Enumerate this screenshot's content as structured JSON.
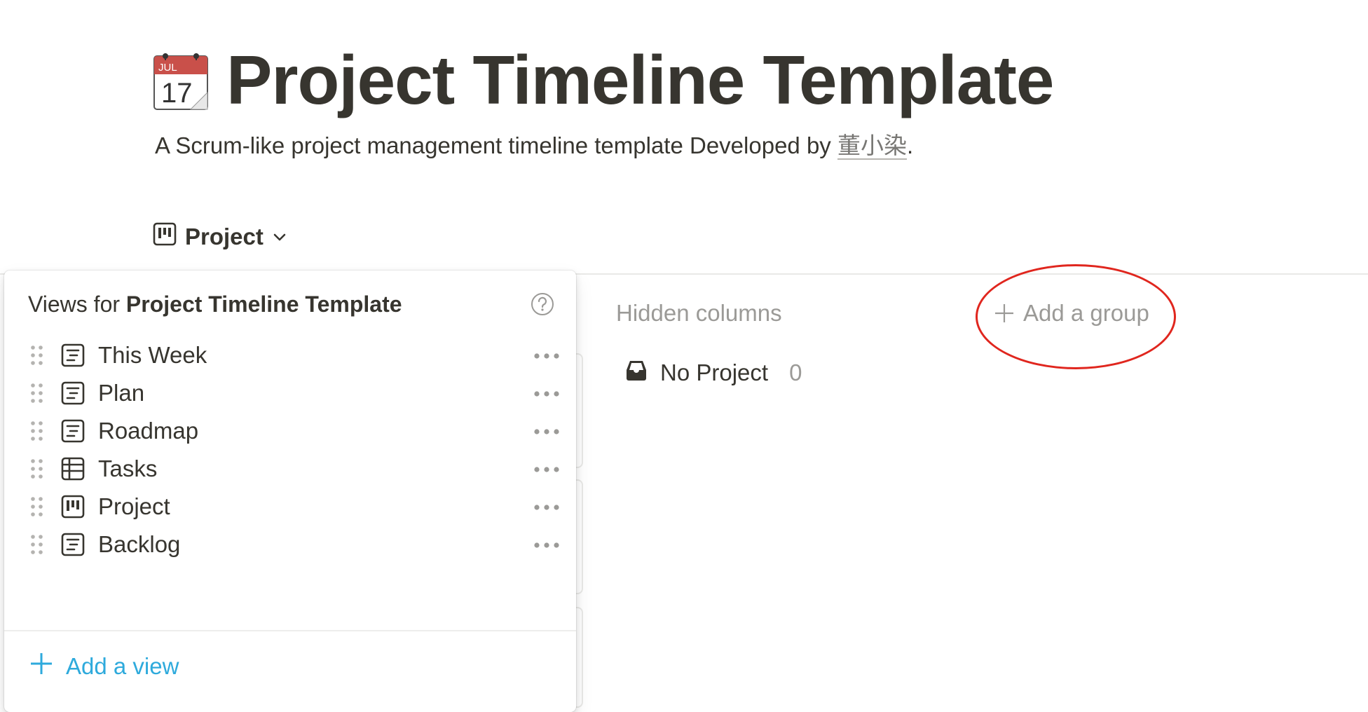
{
  "page": {
    "icon": "calendar-emoji-icon",
    "icon_month": "JUL",
    "icon_day": "17",
    "title": "Project Timeline Template",
    "subtitle_text": "A Scrum-like project management timeline template Developed by ",
    "author": "董小染",
    "subtitle_end": "."
  },
  "view_switcher": {
    "icon": "board-icon",
    "label": "Project",
    "chevron": "chevron-down-icon"
  },
  "board": {
    "hidden_columns_label": "Hidden columns",
    "add_group_label": "Add a group",
    "groups": [
      {
        "icon": "inbox-icon",
        "name": "No Project",
        "count": "0"
      }
    ]
  },
  "views_popup": {
    "header_prefix": "Views for ",
    "header_db": "Project Timeline Template",
    "help_icon": "question-circle-icon",
    "views": [
      {
        "label": "This Week",
        "icon": "list-icon"
      },
      {
        "label": "Plan",
        "icon": "list-icon"
      },
      {
        "label": "Roadmap",
        "icon": "list-icon"
      },
      {
        "label": "Tasks",
        "icon": "table-icon"
      },
      {
        "label": "Project",
        "icon": "board-icon"
      },
      {
        "label": "Backlog",
        "icon": "list-icon"
      }
    ],
    "add_view_label": "Add a view"
  },
  "colors": {
    "text": "#37352f",
    "muted": "#9b9a97",
    "accent_blue": "#2eaadc",
    "annotation_red": "#e0261e",
    "calendar_red": "#c9504a"
  }
}
